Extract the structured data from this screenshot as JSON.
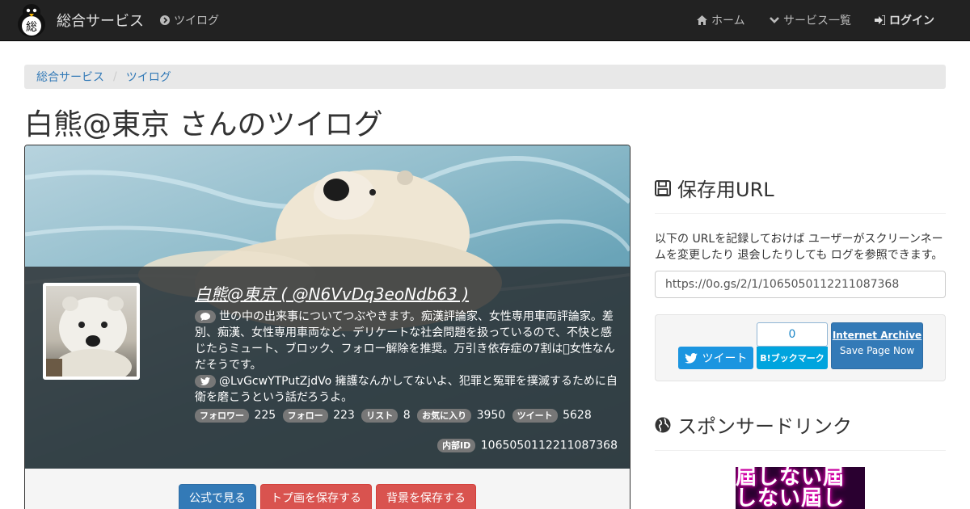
{
  "navbar": {
    "brand": "総合サービス",
    "logo_char": "総",
    "current_service": "ツイログ",
    "home": "ホーム",
    "services": "サービス一覧",
    "login": "ログイン"
  },
  "breadcrumb": [
    "総合サービス",
    "ツイログ"
  ],
  "page_title": "白熊@東京 さんのツイログ",
  "profile": {
    "name": "白熊@東京 ( @N6VvDq3eoNdb63 )",
    "bio": "世の中の出来事についてつぶやきます。痴漢評論家、女性専用車両評論家。差別、痴漢、女性専用車両など、デリケートな社会問題を扱っているので、不快と感じたらミュート、ブロック、フォロー解除を推奨。万引き依存症の7割は\u0000女性なんだそうです。",
    "pinned": "@LvGcwYTPutZjdVo 擁護なんかしてないよ、犯罪と冤罪を撲滅するために自衛を磨こうという話だろうよ。",
    "stats": [
      {
        "label": "フォロワー",
        "value": "225"
      },
      {
        "label": "フォロー",
        "value": "223"
      },
      {
        "label": "リスト",
        "value": "8"
      },
      {
        "label": "お気に入り",
        "value": "3950"
      },
      {
        "label": "ツイート",
        "value": "5628"
      }
    ],
    "internal_label": "内部ID",
    "internal_id": "1065050112211087368"
  },
  "actions": {
    "view_official": "公式で見る",
    "save_top": "トプ画を保存する",
    "save_bg": "背景を保存する"
  },
  "sidebar": {
    "save_heading": "保存用URL",
    "save_desc": "以下の URLを記録しておけば ユーザーがスクリーンネームを変更したり 退会したりしても ログを参照できます。",
    "save_url": "https://0o.gs/2/1/1065050112211087368",
    "tweet": "ツイート",
    "hatena_count": "0",
    "hatena_label": "B!ブックマーク",
    "ia_title": "Internet Archive",
    "ia_sub": "Save Page Now",
    "sponsor_heading": "スポンサードリンク",
    "ad_line1": "屆しない屆",
    "ad_line2": "しない屆し"
  },
  "colors": {
    "navbar": "#222222",
    "link": "#337ab7",
    "primary": "#337ab7",
    "danger": "#d9534f",
    "twitter": "#1b95e0",
    "hatena": "#00a4de"
  }
}
